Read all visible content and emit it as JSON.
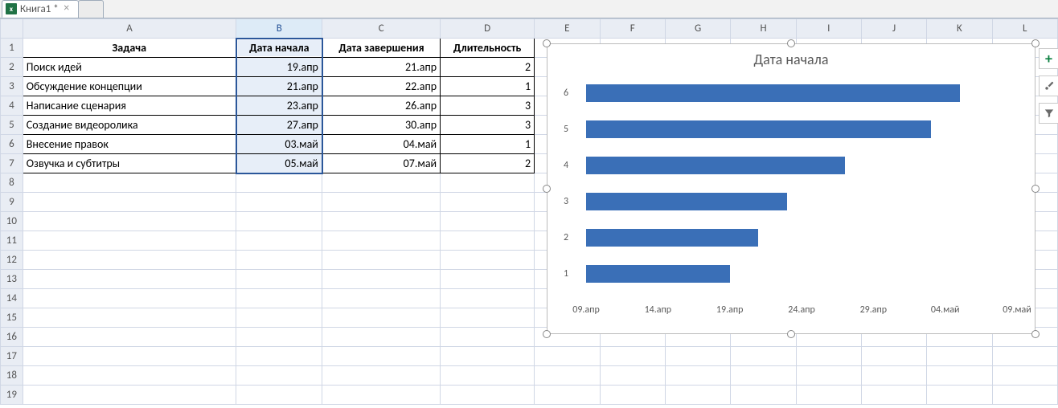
{
  "tab": {
    "name": "Книга1 *"
  },
  "columns": [
    "A",
    "B",
    "C",
    "D",
    "E",
    "F",
    "G",
    "H",
    "I",
    "J",
    "K",
    "L"
  ],
  "headers": {
    "A": "Задача",
    "B": "Дата начала",
    "C": "Дата завершения",
    "D": "Длительность"
  },
  "rows": [
    {
      "A": "Поиск идей",
      "B": "19.апр",
      "C": "21.апр",
      "D": "2"
    },
    {
      "A": "Обсуждение концепции",
      "B": "21.апр",
      "C": "22.апр",
      "D": "1"
    },
    {
      "A": "Написание сценария",
      "B": "23.апр",
      "C": "26.апр",
      "D": "3"
    },
    {
      "A": "Создание видеоролика",
      "B": "27.апр",
      "C": "30.апр",
      "D": "3"
    },
    {
      "A": "Внесение правок",
      "B": "03.май",
      "C": "04.май",
      "D": "1"
    },
    {
      "A": "Озвучка и субтитры",
      "B": "05.май",
      "C": "07.май",
      "D": "2"
    }
  ],
  "row_count_visible": 19,
  "selection": {
    "column": "B",
    "row_start": 1,
    "row_end": 7
  },
  "chart_data": {
    "type": "bar",
    "orientation": "horizontal",
    "title": "Дата начала",
    "categories": [
      "1",
      "2",
      "3",
      "4",
      "5",
      "6"
    ],
    "x_ticks": [
      "09.апр",
      "14.апр",
      "19.апр",
      "24.апр",
      "29.апр",
      "04.май",
      "09.май"
    ],
    "x_serial": [
      43929,
      43934,
      43939,
      43944,
      43949,
      43954,
      43959
    ],
    "series": [
      {
        "name": "Дата начала",
        "values": [
          43939,
          43941,
          43943,
          43947,
          43953,
          43955
        ]
      }
    ],
    "xlim": [
      43929,
      43959
    ],
    "bar_color": "#3a6fb7"
  },
  "side_tools": {
    "add": "plus-icon",
    "style": "brush-icon",
    "filter": "funnel-icon"
  }
}
